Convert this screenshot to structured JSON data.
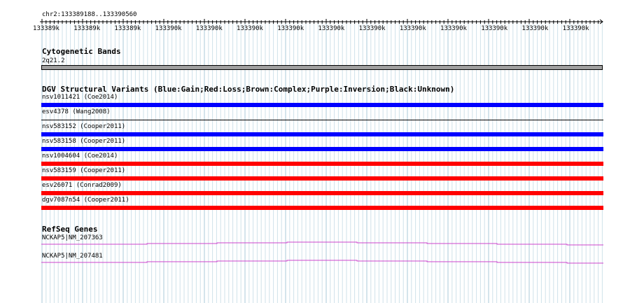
{
  "ruler": {
    "location": "chr2:133389188..133390560",
    "ticks": [
      "133389k",
      "133389k",
      "133389k",
      "133390k",
      "133390k",
      "133390k",
      "133390k",
      "133390k",
      "133390k",
      "133390k",
      "133390k",
      "133390k",
      "133390k",
      "133390k"
    ]
  },
  "cytoband": {
    "title": "Cytogenetic Bands",
    "band": "2q21.2",
    "band_color": "#a0a0a0"
  },
  "dgv": {
    "title": "DGV Structural Variants (Blue:Gain;Red:Loss;Brown:Complex;Purple:Inversion;Black:Unknown)",
    "variants": [
      {
        "label": "nsv1011421 (Coe2014)",
        "type": "gain",
        "color": "#0000ff"
      },
      {
        "label": "esv4378 (Wang2008)",
        "type": "unknown",
        "color": "#000000"
      },
      {
        "label": "nsv583152 (Cooper2011)",
        "type": "gain",
        "color": "#0000ff"
      },
      {
        "label": "nsv583158 (Cooper2011)",
        "type": "gain",
        "color": "#0000ff"
      },
      {
        "label": "nsv1004604 (Coe2014)",
        "type": "loss",
        "color": "#ff0000"
      },
      {
        "label": "nsv583159 (Cooper2011)",
        "type": "loss",
        "color": "#ff0000"
      },
      {
        "label": "esv26071 (Conrad2009)",
        "type": "loss",
        "color": "#ff0000"
      },
      {
        "label": "dgv7087n54 (Cooper2011)",
        "type": "loss",
        "color": "#ff0000"
      }
    ]
  },
  "refseq": {
    "title": "RefSeq Genes",
    "transcript_color": "#cc44cc",
    "genes": [
      {
        "label": "NCKAP5|NM_207363"
      },
      {
        "label": "NCKAP5|NM_207481"
      }
    ]
  }
}
